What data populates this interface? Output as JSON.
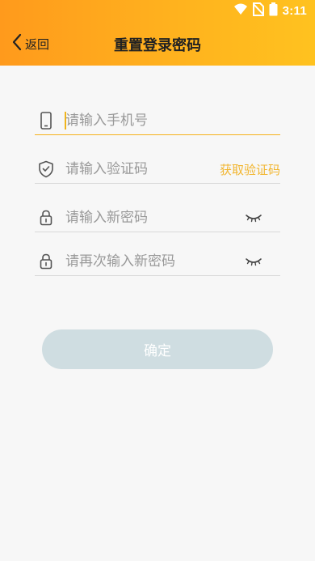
{
  "status_bar": {
    "time": "3:11"
  },
  "header": {
    "back_label": "返回",
    "title": "重置登录密码"
  },
  "form": {
    "phone_placeholder": "请输入手机号",
    "code_placeholder": "请输入验证码",
    "get_code_label": "获取验证码",
    "new_password_placeholder": "请输入新密码",
    "confirm_password_placeholder": "请再次输入新密码"
  },
  "confirm_label": "确定",
  "colors": {
    "header_gradient_start": "#ff9a1c",
    "header_gradient_end": "#ffc21f",
    "accent": "#f2b630",
    "button_disabled": "#cfdde1"
  }
}
